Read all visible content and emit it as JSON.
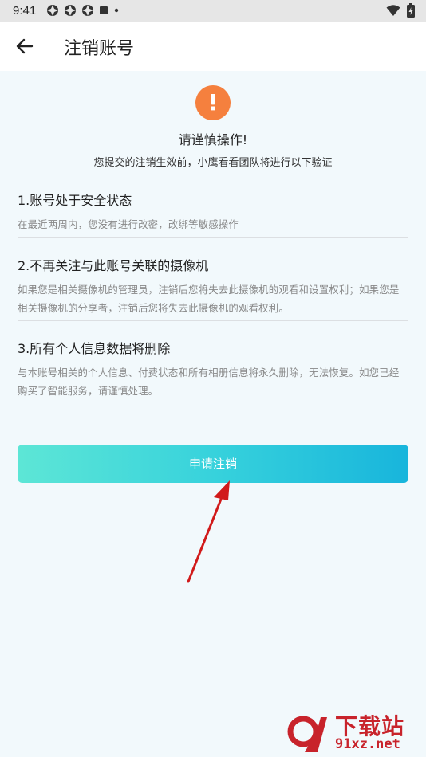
{
  "status_bar": {
    "time": "9:41"
  },
  "header": {
    "title": "注销账号"
  },
  "warning": {
    "icon_glyph": "!",
    "title": "请谨慎操作!",
    "subtitle": "您提交的注销生效前，小鹰看看团队将进行以下验证"
  },
  "sections": [
    {
      "title": "1.账号处于安全状态",
      "desc": "在最近两周内，您没有进行改密，改绑等敏感操作"
    },
    {
      "title": "2.不再关注与此账号关联的摄像机",
      "desc": "如果您是相关摄像机的管理员，注销后您将失去此摄像机的观看和设置权利；如果您是相关摄像机的分享者，注销后您将失去此摄像机的观看权利。"
    },
    {
      "title": "3.所有个人信息数据将删除",
      "desc": "与本账号相关的个人信息、付费状态和所有相册信息将永久删除，无法恢复。如您已经购买了智能服务，请谨慎处理。"
    }
  ],
  "apply_button": {
    "label": "申请注销"
  },
  "watermark": {
    "title": "下载站",
    "url": "91xz.net"
  },
  "colors": {
    "warning": "#f5803e",
    "button_start": "#5de6d6",
    "button_end": "#18b5dc",
    "arrow": "#d11a1a"
  }
}
